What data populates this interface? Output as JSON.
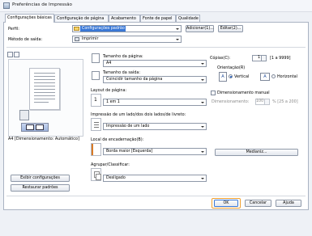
{
  "window": {
    "title": "Preferências de Impressão"
  },
  "tabs": [
    {
      "label": "Configurações básicas"
    },
    {
      "label": "Configuração de página"
    },
    {
      "label": "Acabamento"
    },
    {
      "label": "Fonte de papel"
    },
    {
      "label": "Qualidade"
    }
  ],
  "profile": {
    "label": "Perfil:",
    "value": "Configurações padrão",
    "add_button": "Adicionar(1)...",
    "edit_button": "Editar(2)..."
  },
  "output": {
    "label": "Método de saída:",
    "value": "Imprimir"
  },
  "preview": {
    "caption": "A4 [Dimensionamento: Automático]",
    "view_settings": "Exibir configurações",
    "restore": "Restaurar padrões"
  },
  "page_size": {
    "label": "Tamanho da página:",
    "value": "A4"
  },
  "output_size": {
    "label": "Tamanho da saída:",
    "value": "Coincidir tamanho da página"
  },
  "copies": {
    "label": "Cópias(C):",
    "value": "1",
    "range": "[1 a 9999]"
  },
  "orientation": {
    "label": "Orientação(R)",
    "portrait": "Vertical",
    "landscape": "Horizontal",
    "selected": "Vertical"
  },
  "manual_scaling": {
    "label": "Dimensionamento manual",
    "sub_label": "Dimensionamento:",
    "value": "100",
    "range": "% [25 a 200]"
  },
  "layout": {
    "label": "Layout de página:",
    "value": "1 em 1"
  },
  "duplex": {
    "label": "Impressão de um lado/dos dois lados/de livreto:",
    "value": "Impressão de um lado"
  },
  "binding": {
    "label": "Local de encadernação(B):",
    "value": "Borda maior [Esquerda]",
    "margin_button": "Medianiz..."
  },
  "collate": {
    "label": "Agrupar/Classificar:",
    "value": "Desligado"
  },
  "footer": {
    "ok": "OK",
    "cancel": "Cancelar",
    "help": "Ajuda"
  },
  "colors": {
    "ok_highlight": "#f0a030",
    "profile_selection": "#3a78d6"
  }
}
